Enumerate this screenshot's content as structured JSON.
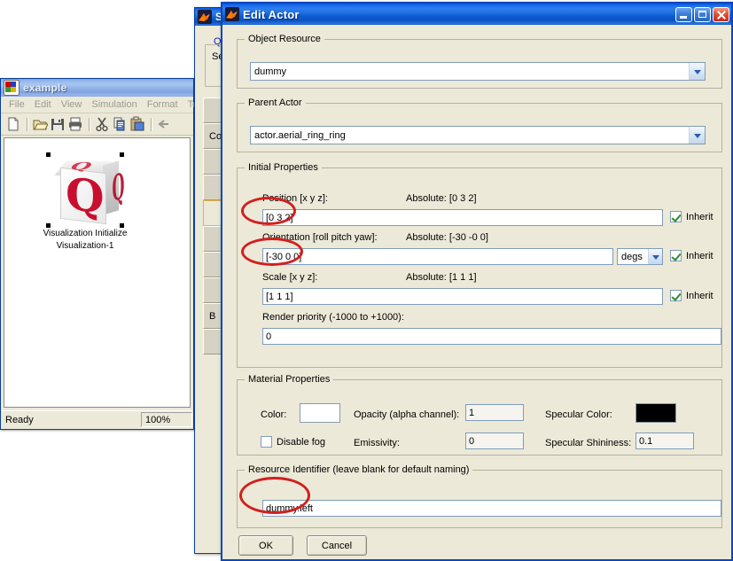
{
  "example_window": {
    "title": "example",
    "icon": "simulink-model-icon",
    "menus": [
      "File",
      "Edit",
      "View",
      "Simulation",
      "Format",
      "To"
    ],
    "toolbar_icons": [
      "new-file-icon",
      "open-folder-icon",
      "save-icon",
      "print-icon",
      "cut-scissors-icon",
      "copy-icon",
      "paste-icon",
      "undo-arrow-icon"
    ],
    "block": {
      "glyph": "Q",
      "label_line1": "Visualization Initialize",
      "label_line2": "Visualization-1",
      "selected": true
    },
    "status": {
      "message": "Ready",
      "zoom": "100%"
    }
  },
  "background_window": {
    "title": "S",
    "icon": "matlab-icon",
    "link_text": "Q",
    "group_text": "Se",
    "list_items": [
      "",
      "Co",
      "",
      "",
      "",
      "",
      "",
      "",
      "B",
      ""
    ],
    "selected_index": 4
  },
  "dialog": {
    "title": "Edit Actor",
    "icon": "matlab-icon",
    "window_buttons": {
      "minimize": "minimize-icon",
      "maximize": "maximize-icon",
      "close": "close-icon"
    },
    "object_resource": {
      "legend": "Object Resource",
      "value": "dummy"
    },
    "parent_actor": {
      "legend": "Parent Actor",
      "value": "actor.aerial_ring_ring"
    },
    "initial_properties": {
      "legend": "Initial Properties",
      "position": {
        "label": "Position [x y z]:",
        "absolute_label": "Absolute: [0 3 2]",
        "value": "[0 3 2]",
        "inherit_label": "Inherit",
        "inherit_checked": true
      },
      "orientation": {
        "label": "Orientation [roll pitch yaw]:",
        "absolute_label": "Absolute: [-30 -0 0]",
        "value": "[-30 0 0]",
        "units": "degs",
        "inherit_label": "Inherit",
        "inherit_checked": true
      },
      "scale": {
        "label": "Scale [x y z]:",
        "absolute_label": "Absolute: [1 1 1]",
        "value": "[1 1 1]",
        "inherit_label": "Inherit",
        "inherit_checked": true
      },
      "render_priority": {
        "label": "Render priority (-1000 to +1000):",
        "value": "0"
      }
    },
    "material_properties": {
      "legend": "Material Properties",
      "color_label": "Color:",
      "color_value": "#ffffff",
      "disable_fog_label": "Disable fog",
      "disable_fog_checked": false,
      "opacity_label": "Opacity (alpha channel):",
      "opacity_value": "1",
      "emissivity_label": "Emissivity:",
      "emissivity_value": "0",
      "specular_color_label": "Specular Color:",
      "specular_color_value": "#000000",
      "specular_shininess_label": "Specular Shininess:",
      "specular_shininess_value": "0.1"
    },
    "resource_identifier": {
      "legend": "Resource Identifier (leave blank for default naming)",
      "value": "dummy.left"
    },
    "buttons": {
      "ok": "OK",
      "cancel": "Cancel"
    }
  },
  "annotations": {
    "color": "#d21f1f",
    "items": [
      "position-field-highlight",
      "orientation-field-highlight",
      "resource-identifier-field-highlight"
    ]
  }
}
